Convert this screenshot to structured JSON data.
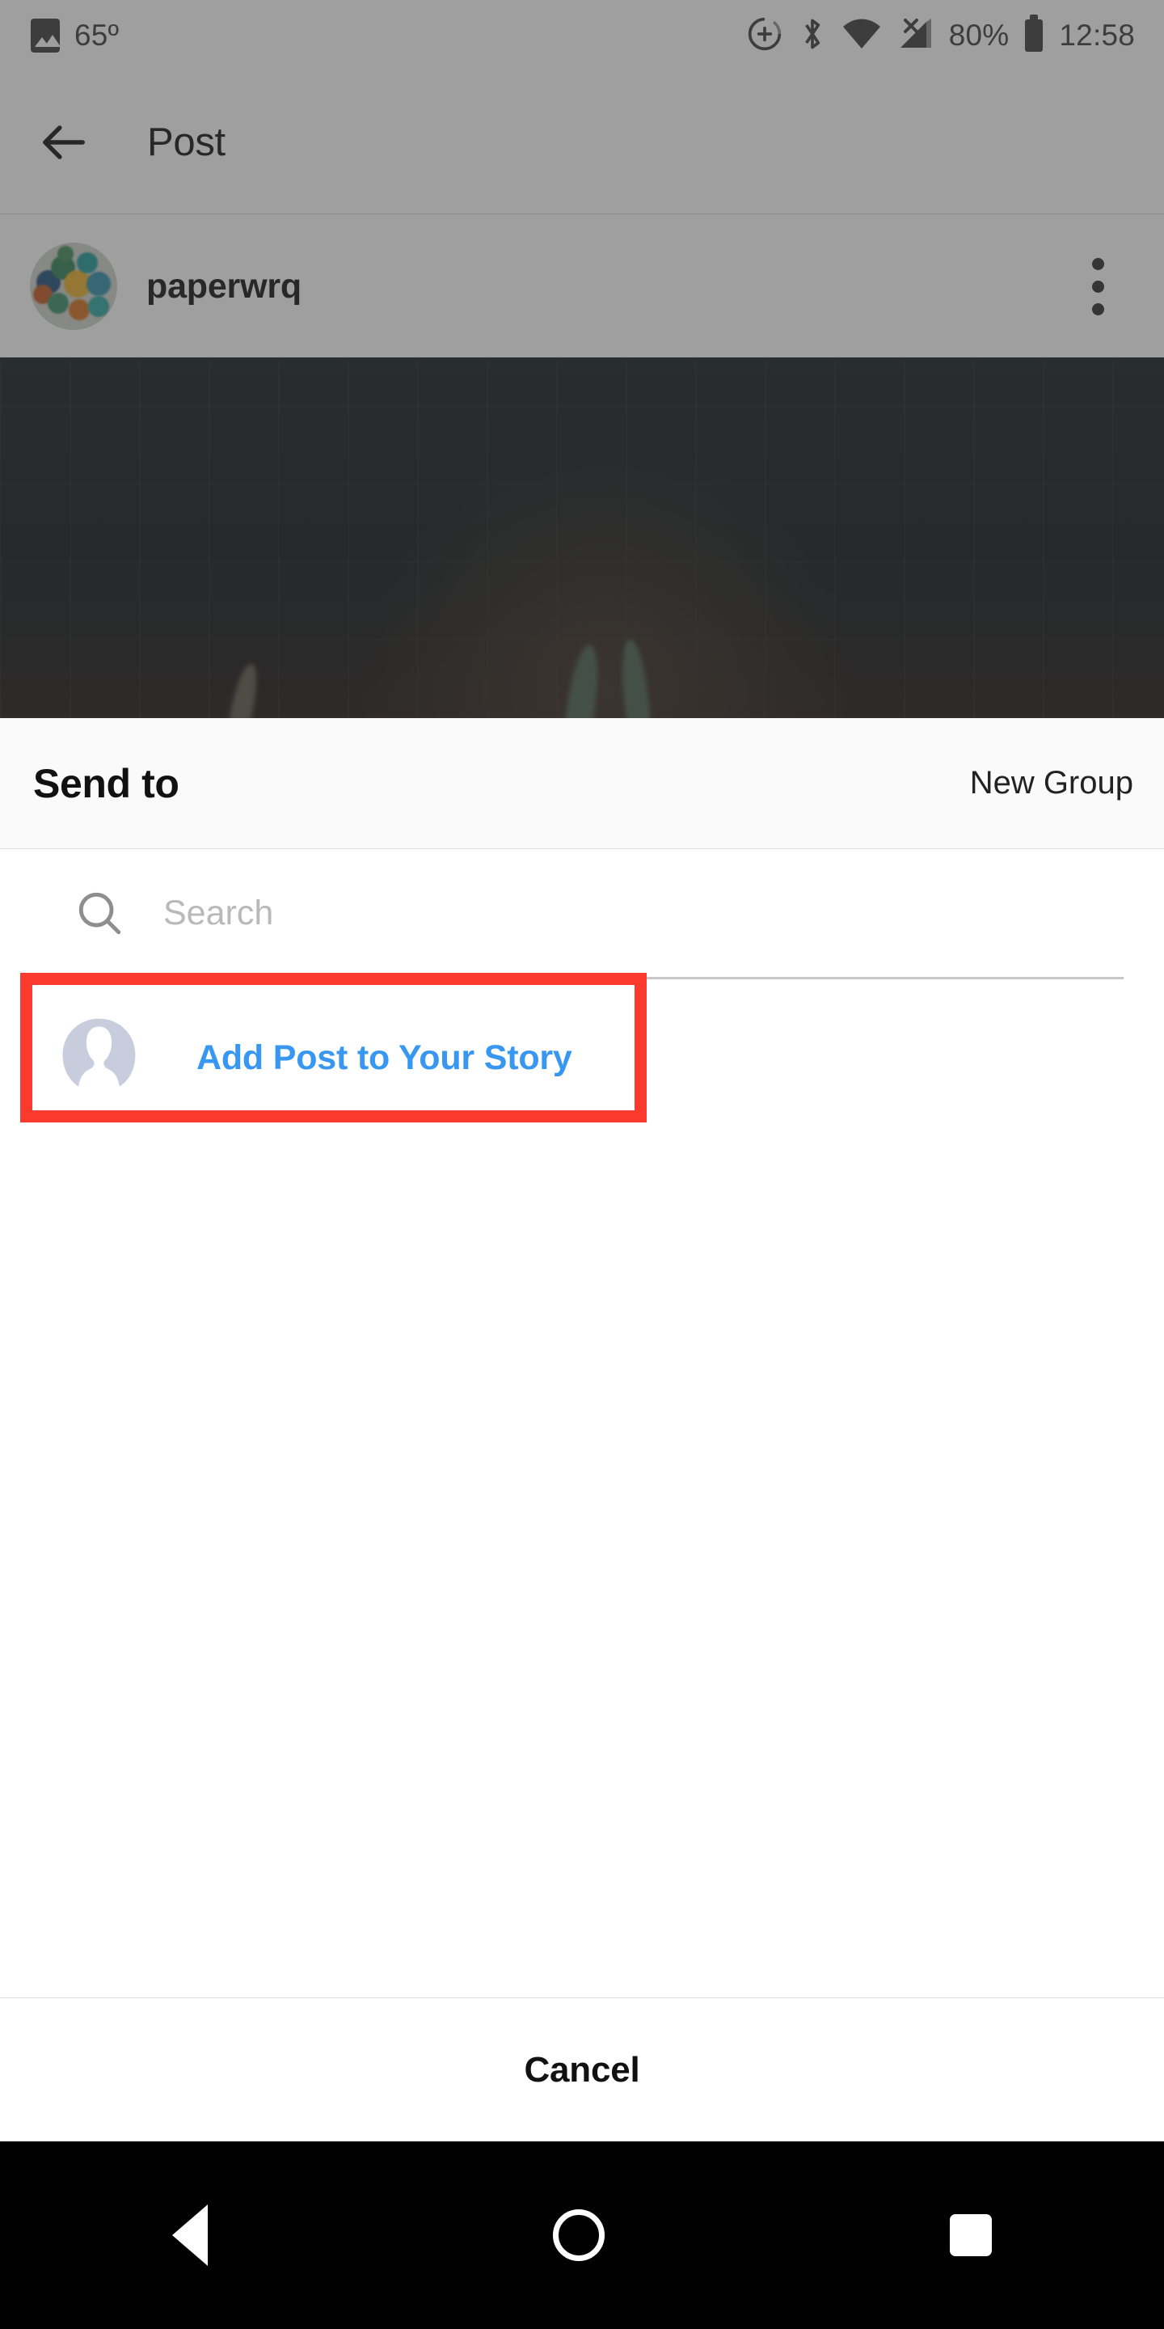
{
  "status_bar": {
    "temperature": "65º",
    "photo_icon": "photo-icon",
    "dnd_icon": "do-not-disturb-icon",
    "bluetooth_icon": "bluetooth-icon",
    "wifi_icon": "wifi-icon",
    "cell_icon": "cell-signal-no-service-icon",
    "battery_percent": "80%",
    "battery_icon": "battery-icon",
    "clock": "12:58"
  },
  "app_bar": {
    "back_icon": "back-arrow-icon",
    "title": "Post"
  },
  "post_header": {
    "avatar": "user-avatar",
    "username": "paperwrq",
    "more_icon": "more-options-icon"
  },
  "post_image": {
    "alt": "dark photo of tiled wall with plants"
  },
  "sheet": {
    "title": "Send to",
    "new_group_label": "New Group",
    "search": {
      "icon": "search-icon",
      "value": "",
      "placeholder": "Search"
    },
    "rows": [
      {
        "avatar": "default-profile-avatar",
        "label": "Add Post to Your Story",
        "highlighted": true
      }
    ],
    "cancel_label": "Cancel"
  },
  "nav_bar": {
    "back_label": "back-triangle-icon",
    "home_label": "home-circle-icon",
    "recents_label": "recents-square-icon"
  },
  "colors": {
    "accent_blue": "#3897f0",
    "highlight_red": "#fb3a2e",
    "sheet_header_bg": "#fafafa",
    "divider": "#dcdcdc",
    "text_primary": "#111111",
    "placeholder": "#b9b9b9",
    "default_avatar": "#c8cddd"
  }
}
